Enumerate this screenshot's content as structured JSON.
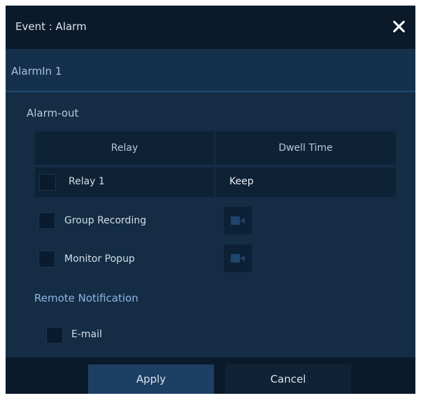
{
  "dialog": {
    "title": "Event : Alarm",
    "alarm_input": "AlarmIn 1",
    "alarm_out_label": "Alarm-out",
    "table": {
      "columns": [
        "Relay",
        "Dwell Time"
      ],
      "relay_row": {
        "label": "Relay 1",
        "dwell_value": "Keep"
      }
    },
    "options": [
      {
        "label": "Group Recording",
        "icon": "camera-icon"
      },
      {
        "label": "Monitor Popup",
        "icon": "camera-icon"
      }
    ],
    "remote_notification_label": "Remote Notification",
    "email_label": "E-mail"
  },
  "footer": {
    "apply_label": "Apply",
    "cancel_label": "Cancel"
  },
  "colors": {
    "background": "#142d45",
    "titlebar": "#0b1a2b",
    "accent_text": "#8fb6e6",
    "apply_button": "#1e3f64"
  }
}
